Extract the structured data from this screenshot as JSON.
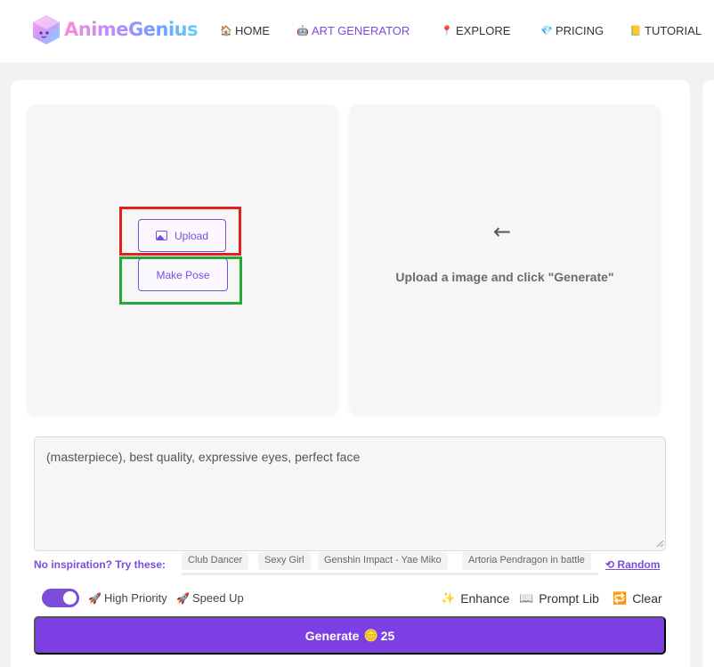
{
  "brand": {
    "name": "AnimeGenius"
  },
  "nav": [
    {
      "label": "HOME",
      "icon": "home-icon"
    },
    {
      "label": "ART GENERATOR",
      "icon": "robot-icon",
      "active": true
    },
    {
      "label": "EXPLORE",
      "icon": "pin-icon"
    },
    {
      "label": "PRICING",
      "icon": "diamond-icon"
    },
    {
      "label": "TUTORIAL",
      "icon": "book-icon"
    }
  ],
  "upload_panel": {
    "upload_label": "Upload",
    "make_pose_label": "Make Pose"
  },
  "result_panel": {
    "hint": "Upload a image and click \"Generate\""
  },
  "prompt": {
    "value": "(masterpiece), best quality, expressive eyes, perfect face"
  },
  "inspiration": {
    "label": "No inspiration? Try these:",
    "chips": [
      "Club Dancer",
      "Sexy Girl",
      "Genshin Impact - Yae Miko",
      "Artoria Pendragon in battle"
    ],
    "random_label": "Random"
  },
  "options": {
    "high_priority_on": true,
    "high_priority_label": "High Priority",
    "speed_up_label": "Speed Up",
    "enhance_label": "Enhance",
    "prompt_lib_label": "Prompt Lib",
    "clear_label": "Clear"
  },
  "generate": {
    "label": "Generate",
    "cost": "25"
  },
  "annotations": {
    "upload_highlight_color": "#e0221c",
    "make_pose_highlight_color": "#25a83a"
  },
  "colors": {
    "accent": "#7a4ddb",
    "button": "#7b3fe4"
  }
}
